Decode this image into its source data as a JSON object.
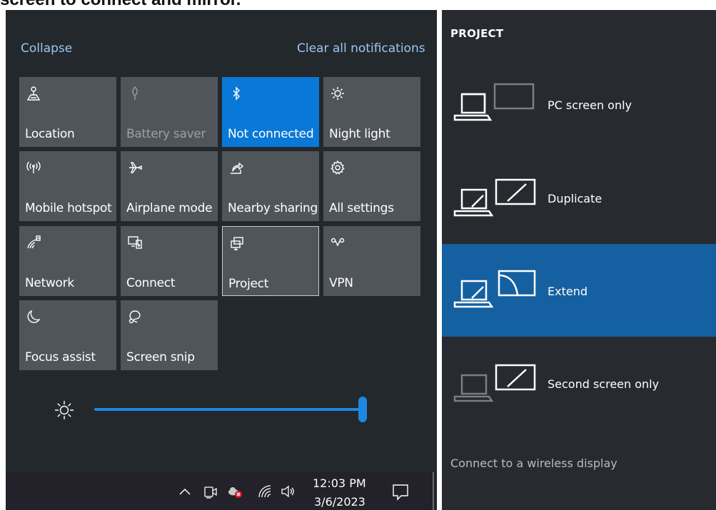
{
  "caption": "screen to connect and mirror.",
  "action_center": {
    "collapse_label": "Collapse",
    "clear_label": "Clear all notifications",
    "tiles": [
      {
        "label": "Location",
        "icon": "location-icon",
        "state": "on"
      },
      {
        "label": "Battery saver",
        "icon": "battery-saver-icon",
        "state": "disabled"
      },
      {
        "label": "Not connected",
        "icon": "bluetooth-icon",
        "state": "on"
      },
      {
        "label": "Night light",
        "icon": "night-light-icon",
        "state": "off"
      },
      {
        "label": "Mobile hotspot",
        "icon": "hotspot-icon",
        "state": "off"
      },
      {
        "label": "Airplane mode",
        "icon": "airplane-icon",
        "state": "off"
      },
      {
        "label": "Nearby sharing",
        "icon": "share-icon",
        "state": "off"
      },
      {
        "label": "All settings",
        "icon": "gear-icon",
        "state": "off"
      },
      {
        "label": "Network",
        "icon": "network-icon",
        "state": "off"
      },
      {
        "label": "Connect",
        "icon": "connect-icon",
        "state": "off"
      },
      {
        "label": "Project",
        "icon": "project-icon",
        "state": "selected"
      },
      {
        "label": "VPN",
        "icon": "vpn-icon",
        "state": "off"
      },
      {
        "label": "Focus assist",
        "icon": "moon-icon",
        "state": "off"
      },
      {
        "label": "Screen snip",
        "icon": "scissors-icon",
        "state": "off"
      }
    ],
    "brightness_level": 1.0
  },
  "taskbar": {
    "time": "12:03 PM",
    "date": "3/6/2023"
  },
  "project_panel": {
    "title": "PROJECT",
    "options": [
      {
        "label": "PC screen only",
        "selected": false
      },
      {
        "label": "Duplicate",
        "selected": false
      },
      {
        "label": "Extend",
        "selected": true
      },
      {
        "label": "Second screen only",
        "selected": false
      }
    ],
    "wireless_label": "Connect to a wireless display"
  },
  "colors": {
    "accent": "#0a78d7",
    "selected_option": "#1560a0",
    "tile": "#50555a",
    "panel": "#23282d"
  }
}
